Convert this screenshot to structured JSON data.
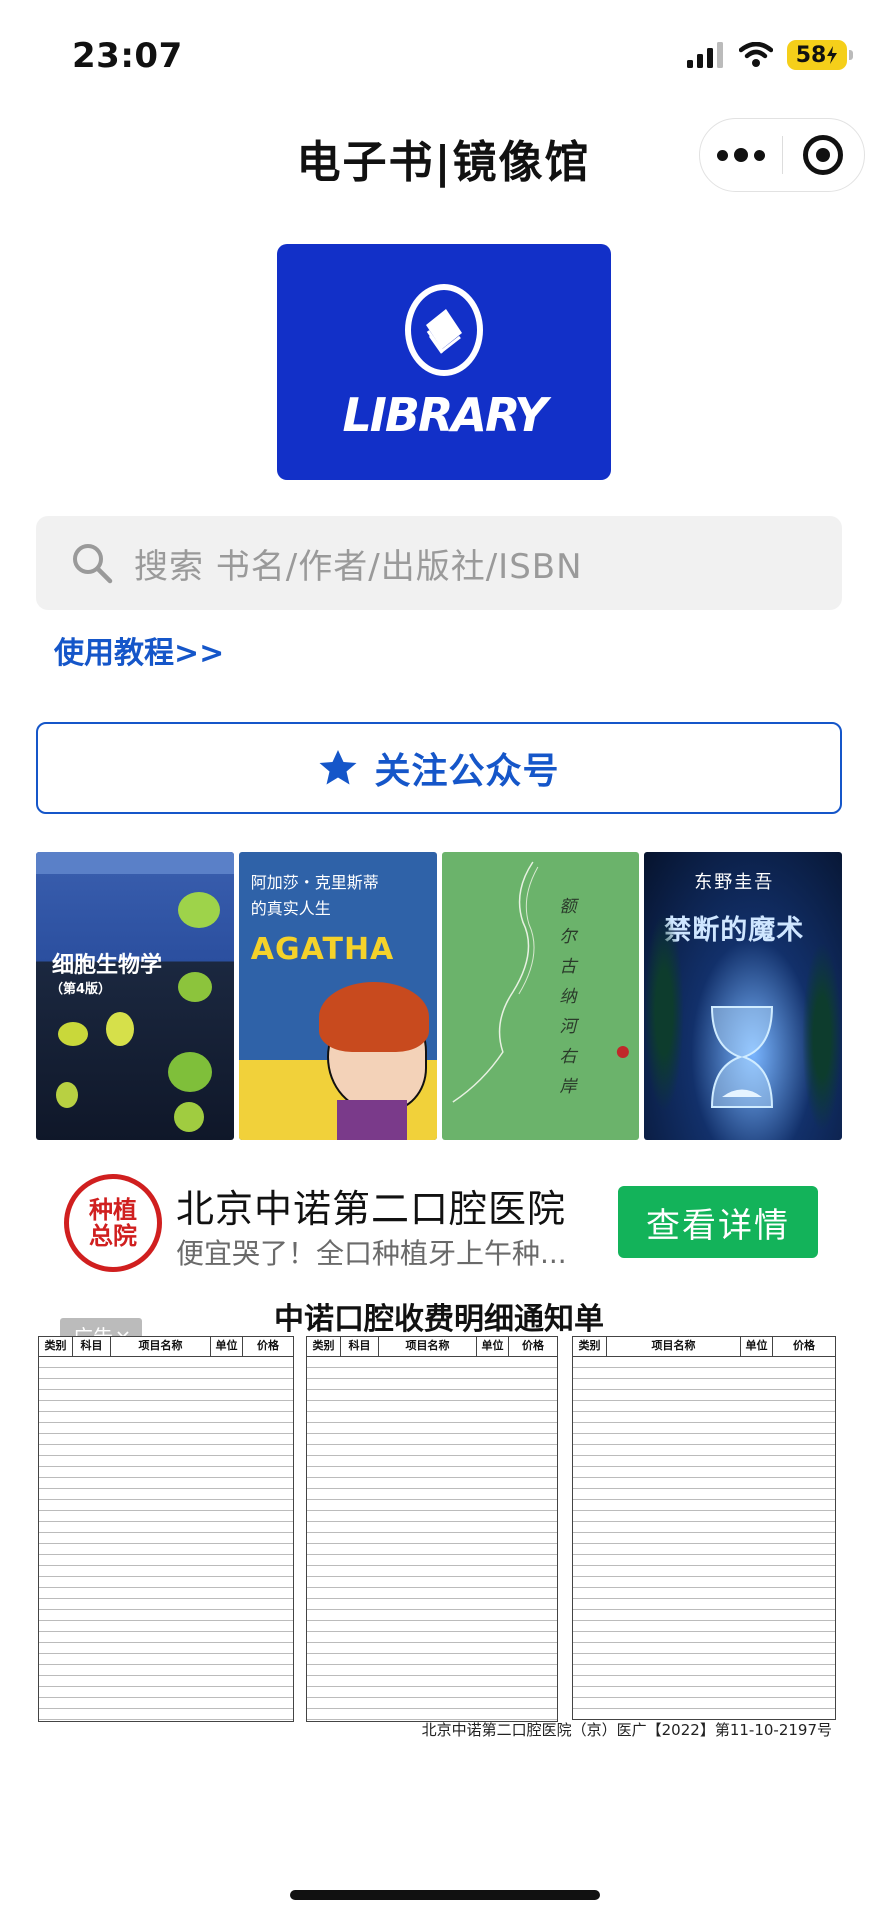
{
  "status_bar": {
    "time": "23:07",
    "battery": "58"
  },
  "header": {
    "title": "电子书|镜像馆"
  },
  "logo": {
    "text": "LIBRARY"
  },
  "search": {
    "placeholder": "搜索 书名/作者/出版社/ISBN"
  },
  "tutorial": {
    "label": "使用教程>>"
  },
  "follow": {
    "label": "关注公众号"
  },
  "books": [
    {
      "title": "细胞生物学",
      "edition": "（第4版）",
      "cover_color": "#2b4f9f"
    },
    {
      "title": "阿加莎・克里斯蒂的真实人生",
      "subtitle": "AGATHA",
      "cover_color": "#2f62a8"
    },
    {
      "title": "额尔古纳河右岸",
      "cover_color": "#6bb36b"
    },
    {
      "title": "禁断的魔术",
      "author": "东野圭吾",
      "cover_color": "#06132d"
    }
  ],
  "ad": {
    "logo_text_1": "种植",
    "logo_text_2": "总院",
    "title": "北京中诺第二口腔医院",
    "subtitle": "便宜哭了！全口种植牙上午种...",
    "button": "查看详情",
    "badge": "广告",
    "image_title": "中诺口腔收费明细通知单",
    "image_footer": "北京中诺第二口腔医院（京）医广【2022】第11-10-2197号",
    "table_headers": [
      "类别",
      "科目",
      "项目名称",
      "单位",
      "价格"
    ]
  },
  "colors": {
    "accent": "#1556c9",
    "logo_bg": "#1230c8",
    "ad_button": "#13b35a",
    "battery": "#f5cf1a"
  }
}
